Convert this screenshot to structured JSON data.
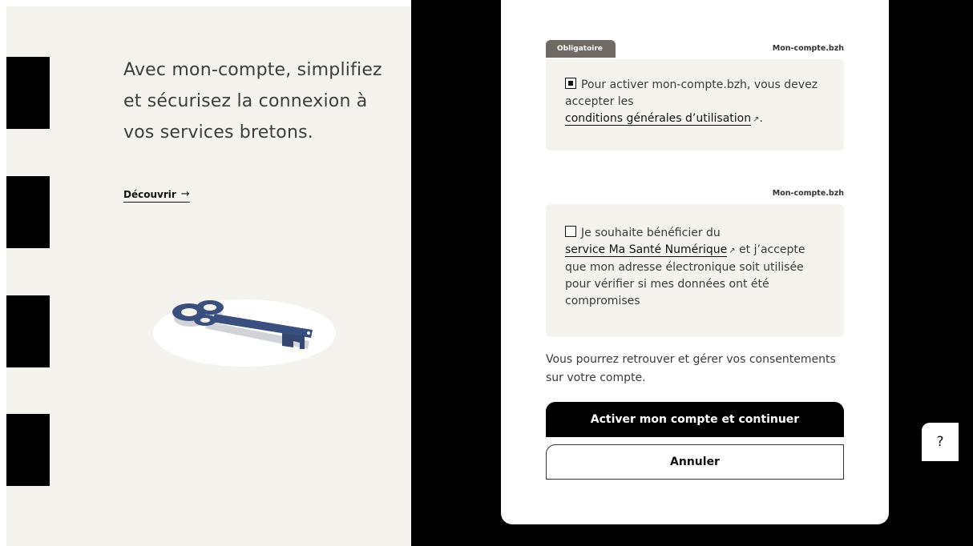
{
  "left": {
    "tagline": "Avec mon-compte, simplifiez et sécurisez la connexion à vos services bretons.",
    "discover_label": "Découvrir",
    "arrow": "→"
  },
  "consents": [
    {
      "badge": "Obligatoire",
      "source": "Mon-compte.bzh",
      "checked": true,
      "text_before": "Pour activer mon-compte.bzh, vous devez accepter les",
      "link_label": "conditions générales d’utilisation",
      "link_icon": "external-link-icon",
      "text_after": "."
    },
    {
      "badge": "",
      "source": "Mon-compte.bzh",
      "checked": false,
      "text_before": "Je souhaite bénéficier du",
      "link_label": "service Ma Santé Numérique",
      "link_icon": "external-link-icon",
      "text_after": "et j’accepte que mon adresse électronique soit utilisée pour vérifier si mes données ont été compromises"
    }
  ],
  "info_text": "Vous pourrez retrouver et gérer vos consentements sur votre compte.",
  "buttons": {
    "primary": "Activer mon compte et continuer",
    "secondary": "Annuler",
    "help": "?"
  },
  "colors": {
    "panel_bg": "#f5f3ed",
    "badge_bg": "#6f6a63",
    "key_blue": "#3b4f7e"
  }
}
